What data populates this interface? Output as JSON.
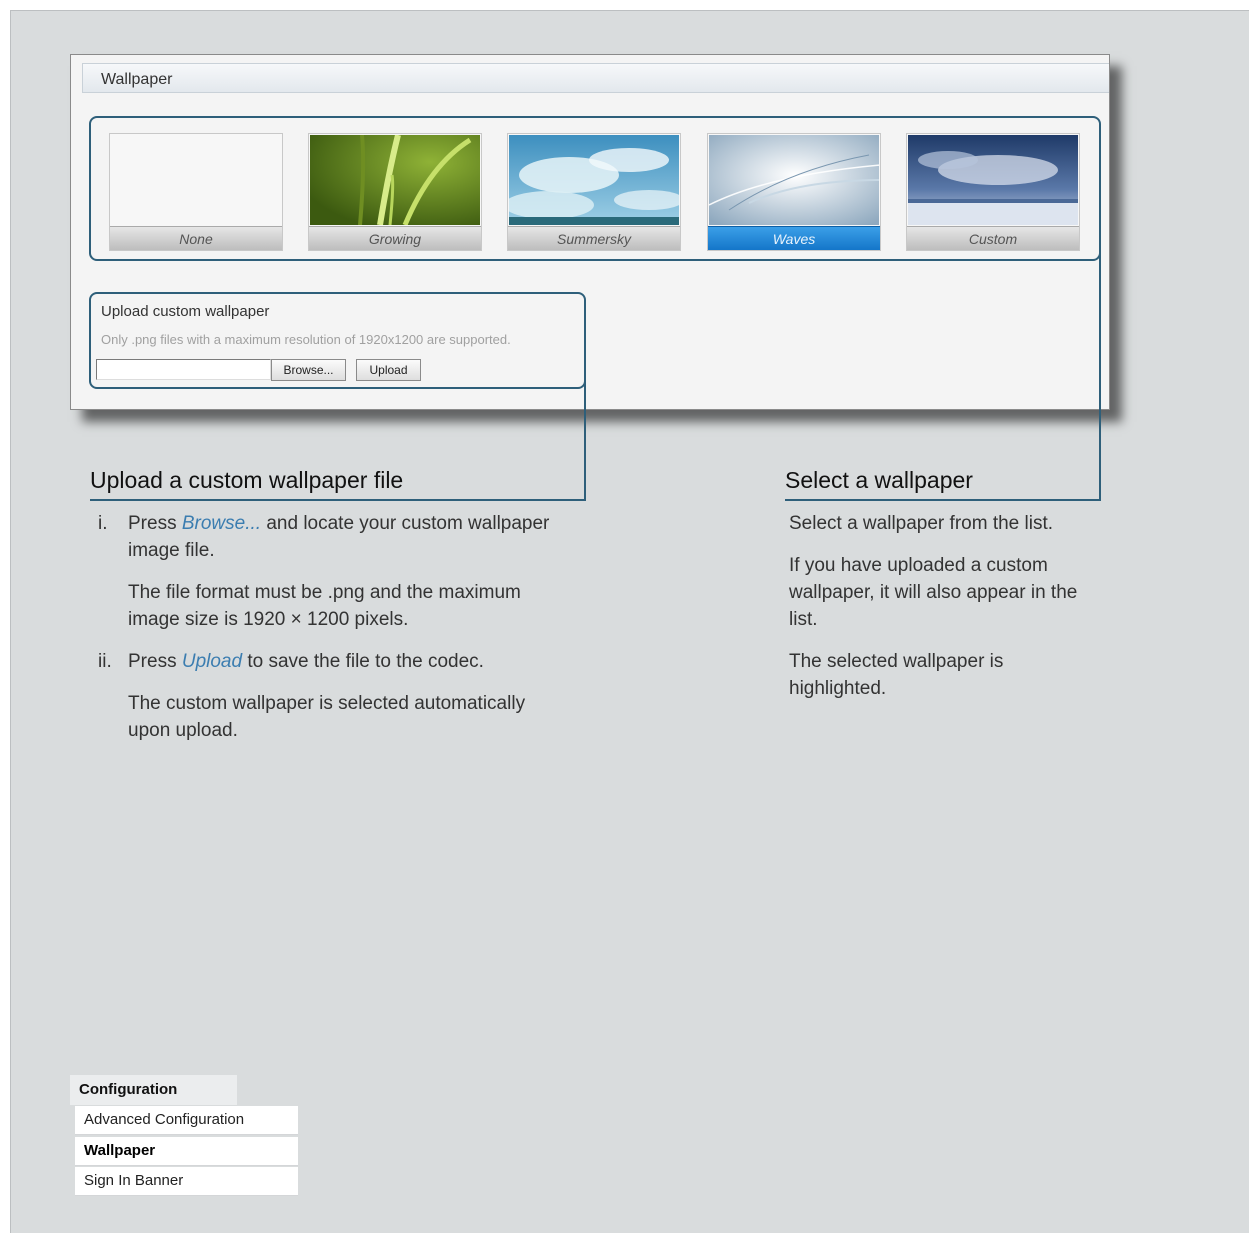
{
  "window": {
    "header_title": "Wallpaper",
    "wallpapers": [
      {
        "label": "None",
        "image": "blank"
      },
      {
        "label": "Growing",
        "image": "green-grass"
      },
      {
        "label": "Summersky",
        "image": "blue-sky-clouds"
      },
      {
        "label": "Waves",
        "image": "light-blue-waves",
        "selected": true
      },
      {
        "label": "Custom",
        "image": "cloudy-sea"
      }
    ],
    "upload": {
      "title": "Upload custom wallpaper",
      "note": "Only .png files with a maximum resolution of 1920x1200 are supported.",
      "file_value": "",
      "browse_label": "Browse...",
      "upload_label": "Upload"
    }
  },
  "left_section": {
    "title": "Upload a custom wallpaper file",
    "step1": {
      "num": "i.",
      "pre": "Press ",
      "link": "Browse...",
      "post": " and locate your custom wallpaper image file.",
      "detail": "The file format must be .png and the maximum image size is 1920 × 1200 pixels."
    },
    "step2": {
      "num": "ii.",
      "pre": "Press ",
      "link": "Upload",
      "post": " to save the file to the codec.",
      "detail": "The custom wallpaper is selected automatically upon upload."
    }
  },
  "right_section": {
    "title": "Select a wallpaper",
    "p1": "Select a wallpaper from the list.",
    "p2": "If you have uploaded a custom wallpaper, it will also appear in the list.",
    "p3": "The selected wallpaper is highlighted."
  },
  "nav": {
    "heading": "Configuration",
    "items": [
      {
        "label": "Advanced Configuration"
      },
      {
        "label": "Wallpaper",
        "active": true
      },
      {
        "label": "Sign In Banner"
      }
    ]
  },
  "colors": {
    "accent": "#2e5f7a",
    "selected": "#1476c9",
    "link": "#3b7db0"
  }
}
